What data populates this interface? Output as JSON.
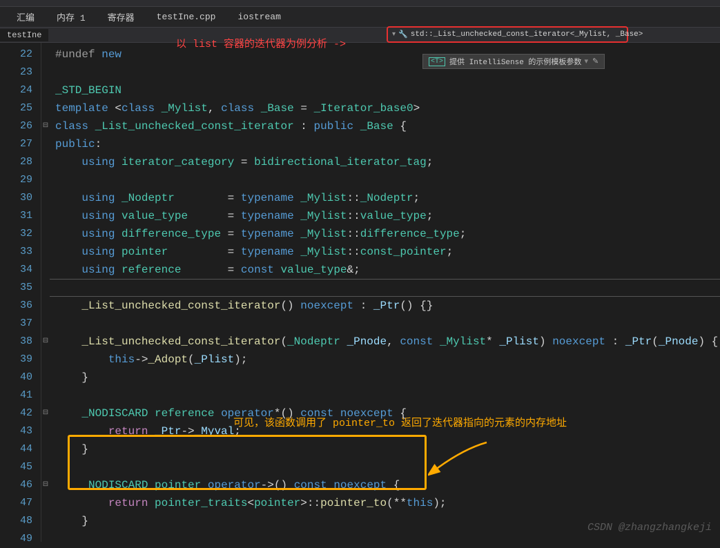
{
  "topbar": {},
  "tabs": {
    "items": [
      {
        "label": "汇编"
      },
      {
        "label": "内存 1"
      },
      {
        "label": "寄存器"
      },
      {
        "label": "testIne.cpp"
      },
      {
        "label": "iostream"
      }
    ]
  },
  "subtab": {
    "label": "testIne"
  },
  "breadcrumb": {
    "icon": "🔧",
    "text": "std::_List_unchecked_const_iterator<_Mylist, _Base>"
  },
  "annotation_red": "以 list 容器的迭代器为例分析 ->",
  "annotation_orange": "可见，该函数调用了 pointer_to 返回了迭代器指向的元素的内存地址",
  "intellisense": {
    "tag": "<T>",
    "text": "提供 IntelliSense 的示例模板参数"
  },
  "lines": {
    "start": 22,
    "end": 49
  },
  "code": {
    "l22": {
      "undef": "#undef",
      "new": "new"
    },
    "l24": {
      "std": "_STD_BEGIN"
    },
    "l25": {
      "template": "template",
      "class1": "class",
      "mylist": "_Mylist",
      "class2": "class",
      "base": "_Base",
      "iterbase": "_Iterator_base0"
    },
    "l26": {
      "class": "class",
      "name": "_List_unchecked_const_iterator",
      "public": "public",
      "base": "_Base"
    },
    "l27": {
      "public": "public"
    },
    "l28": {
      "using": "using",
      "name": "iterator_category",
      "val": "bidirectional_iterator_tag"
    },
    "l30": {
      "using": "using",
      "name": "_Nodeptr",
      "typename": "typename",
      "scope": "_Mylist",
      "member": "_Nodeptr"
    },
    "l31": {
      "using": "using",
      "name": "value_type",
      "typename": "typename",
      "scope": "_Mylist",
      "member": "value_type"
    },
    "l32": {
      "using": "using",
      "name": "difference_type",
      "typename": "typename",
      "scope": "_Mylist",
      "member": "difference_type"
    },
    "l33": {
      "using": "using",
      "name": "pointer",
      "typename": "typename",
      "scope": "_Mylist",
      "member": "const_pointer"
    },
    "l34": {
      "using": "using",
      "name": "reference",
      "const": "const",
      "type": "value_type"
    },
    "l36": {
      "ctor": "_List_unchecked_const_iterator",
      "noexcept": "noexcept",
      "ptr": "_Ptr"
    },
    "l38": {
      "ctor": "_List_unchecked_const_iterator",
      "ptype": "_Nodeptr",
      "pnode": "_Pnode",
      "const": "const",
      "mylist": "_Mylist",
      "plist": "_Plist",
      "noexcept": "noexcept",
      "ptr": "_Ptr"
    },
    "l39": {
      "this": "this",
      "adopt": "_Adopt",
      "plist": "_Plist"
    },
    "l42": {
      "nodiscard": "_NODISCARD",
      "ref": "reference",
      "op": "operator",
      "const": "const",
      "noexcept": "noexcept"
    },
    "l43": {
      "return": "return",
      "ptr": "_Ptr",
      "myval": "_Myval"
    },
    "l46": {
      "nodiscard": "_NODISCARD",
      "ptr": "pointer",
      "op": "operator",
      "const": "const",
      "noexcept": "noexcept"
    },
    "l47": {
      "return": "return",
      "traits": "pointer_traits",
      "pointer": "pointer",
      "fn": "pointer_to",
      "this": "this"
    }
  },
  "watermark": "CSDN @zhangzhangkeji"
}
